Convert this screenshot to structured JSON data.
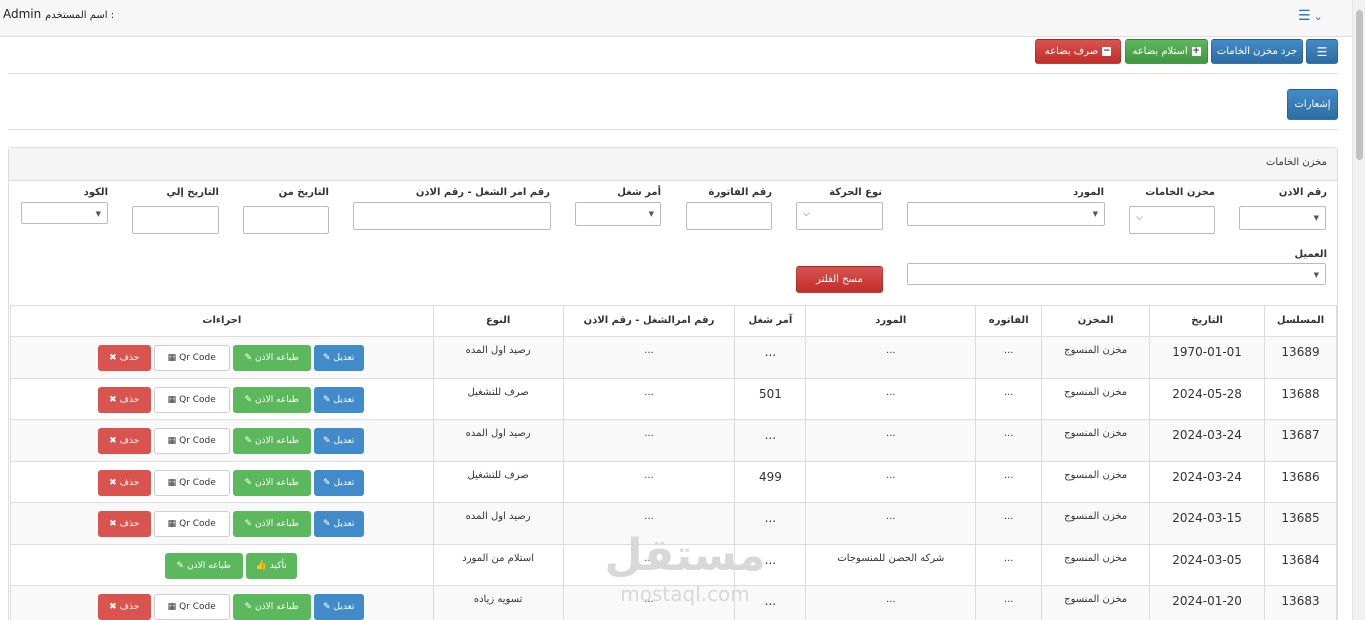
{
  "topbar": {
    "user_label": "اسم المستخدم :",
    "user_name": "Admin"
  },
  "toolbar": {
    "inventory_label": "جرد مخزن الخامات",
    "receive_label": "استلام بضاعه",
    "issue_label": "صرف بضاعه"
  },
  "notifications_label": "إشعارات",
  "panel_title": "مخزن الخامات",
  "filters": {
    "permit_no": "رقم الاذن",
    "warehouse": "مخزن الخامات",
    "supplier": "المورد",
    "movement_type": "نوع الحركة",
    "invoice_no": "رقم الفاتورة",
    "work_order": "أمر شغل",
    "work_order_permit": "رقم امر الشغل - رقم الاذن",
    "date_from": "التاريخ من",
    "date_to": "التاريخ إلي",
    "code": "الكود",
    "client": "العميل",
    "clear_label": "مسح الفلتر"
  },
  "table": {
    "headers": [
      "المسلسل",
      "التاريخ",
      "المخزن",
      "الفاتوره",
      "المورد",
      "آمر شغل",
      "رقم امرالشغل - رقم الاذن",
      "النوع",
      "اجراءات"
    ],
    "rows": [
      {
        "serial": "13689",
        "date": "1970-01-01",
        "store": "مخزن المنسوج",
        "invoice": "...",
        "supplier": "...",
        "order": "...",
        "order_permit": "...",
        "type": "رصيد اول المده"
      },
      {
        "serial": "13688",
        "date": "2024-05-28",
        "store": "مخزن المنسوج",
        "invoice": "...",
        "supplier": "...",
        "order": "501",
        "order_permit": "...",
        "type": "صرف للتشغيل"
      },
      {
        "serial": "13687",
        "date": "2024-03-24",
        "store": "مخزن المنسوج",
        "invoice": "...",
        "supplier": "...",
        "order": "...",
        "order_permit": "...",
        "type": "رصيد اول المده"
      },
      {
        "serial": "13686",
        "date": "2024-03-24",
        "store": "مخزن المنسوج",
        "invoice": "...",
        "supplier": "...",
        "order": "499",
        "order_permit": "...",
        "type": "صرف للتشغيل"
      },
      {
        "serial": "13685",
        "date": "2024-03-15",
        "store": "مخزن المنسوج",
        "invoice": "...",
        "supplier": "...",
        "order": "...",
        "order_permit": "...",
        "type": "رصيد اول المده"
      },
      {
        "serial": "13684",
        "date": "2024-03-05",
        "store": "مخزن المنسوج",
        "invoice": "...",
        "supplier": "شركه الحصن للمنسوجات",
        "order": "...",
        "order_permit": "...",
        "type": "استلام من المورد"
      },
      {
        "serial": "13683",
        "date": "2024-01-20",
        "store": "مخزن المنسوج",
        "invoice": "...",
        "supplier": "...",
        "order": "...",
        "order_permit": "...",
        "type": "تسويه زياده"
      }
    ],
    "actions": {
      "edit": "تعديل",
      "print": "طباعه الاذن",
      "qr": "Qr Code",
      "delete": "حذف",
      "confirm": "تأكيد"
    }
  },
  "watermark": {
    "arabic": "مستقل",
    "latin": "mostaql.com"
  },
  "colors": {
    "primary": "#428bca",
    "success": "#5cb85c",
    "danger": "#d9534f"
  }
}
